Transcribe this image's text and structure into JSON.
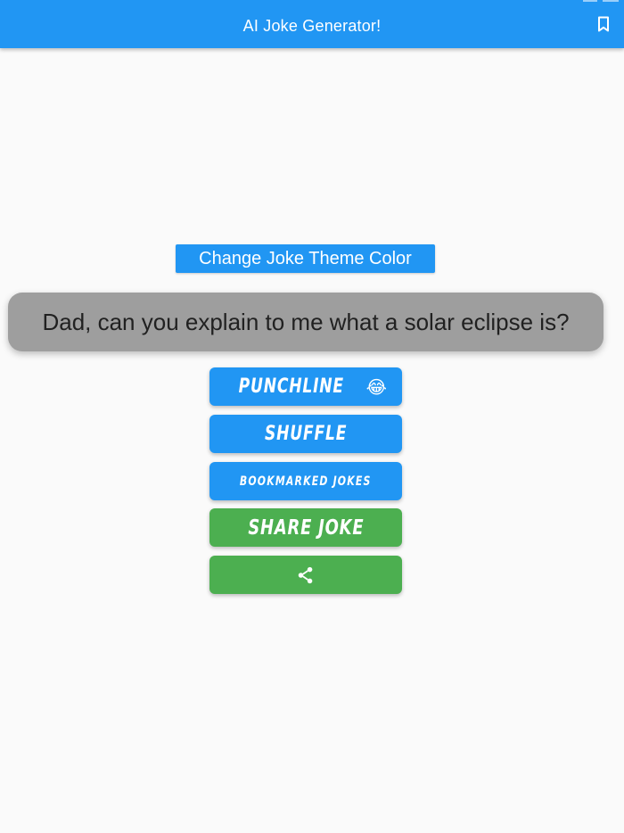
{
  "appbar": {
    "title": "AI Joke Generator!",
    "bookmark_icon": "bookmark-icon",
    "color": "#2196f3"
  },
  "theme_button": {
    "label": "Change Joke Theme Color"
  },
  "joke": {
    "setup": "Dad, can you explain to me what a solar eclipse is?",
    "card_color": "#9e9e9e"
  },
  "buttons": {
    "punchline_label": "Punchline",
    "punchline_emoji": "😂",
    "shuffle_label": "Shuffle",
    "bookmarked_label": "Bookmarked Jokes",
    "share_joke_label": "Share Joke",
    "share_icon": "share-icon"
  },
  "colors": {
    "primary": "#2196f3",
    "success": "#4caf50",
    "background": "#fafafa"
  }
}
